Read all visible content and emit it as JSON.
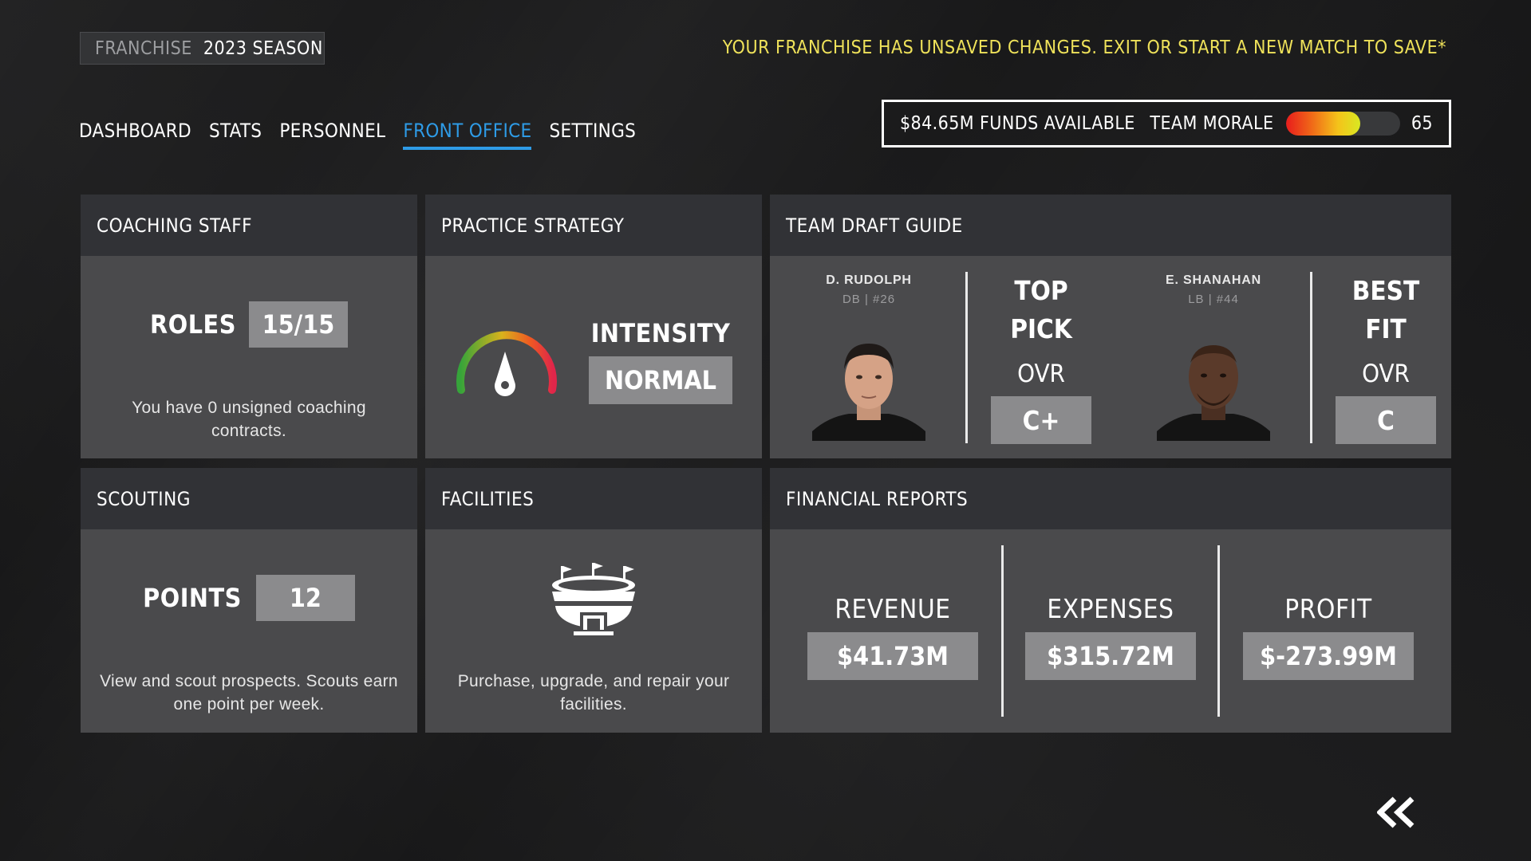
{
  "header": {
    "mode_label": "FRANCHISE",
    "season_label": "2023 SEASON",
    "unsaved_notice": "YOUR FRANCHISE HAS UNSAVED CHANGES. EXIT OR START A NEW MATCH TO SAVE*"
  },
  "nav": {
    "items": [
      "DASHBOARD",
      "STATS",
      "PERSONNEL",
      "FRONT OFFICE",
      "SETTINGS"
    ],
    "active": "FRONT OFFICE"
  },
  "status": {
    "funds": "$84.65M FUNDS AVAILABLE",
    "morale_label": "TEAM MORALE",
    "morale_value": "65",
    "morale_fraction": 0.65
  },
  "coaching": {
    "title": "COACHING STAFF",
    "roles_label": "ROLES",
    "roles_value": "15/15",
    "description": "You have 0 unsigned coaching contracts."
  },
  "practice": {
    "title": "PRACTICE STRATEGY",
    "intensity_label": "INTENSITY",
    "intensity_value": "NORMAL"
  },
  "draft": {
    "title": "TEAM DRAFT GUIDE",
    "players": [
      {
        "name": "D. RUDOLPH",
        "info": "DB | #26",
        "pick_line1": "TOP",
        "pick_line2": "PICK",
        "ovr_label": "OVR",
        "grade": "C+"
      },
      {
        "name": "E. SHANAHAN",
        "info": "LB | #44",
        "pick_line1": "BEST",
        "pick_line2": "FIT",
        "ovr_label": "OVR",
        "grade": "C"
      }
    ]
  },
  "scouting": {
    "title": "SCOUTING",
    "points_label": "POINTS",
    "points_value": "12",
    "description": "View and scout prospects. Scouts earn one point per week."
  },
  "facilities": {
    "title": "FACILITIES",
    "description": "Purchase, upgrade, and repair your facilities."
  },
  "finance": {
    "title": "FINANCIAL REPORTS",
    "revenue_label": "REVENUE",
    "revenue_value": "$41.73M",
    "expenses_label": "EXPENSES",
    "expenses_value": "$315.72M",
    "profit_label": "PROFIT",
    "profit_value": "$-273.99M"
  },
  "icons": {
    "gauge": "intensity-gauge-icon",
    "stadium": "stadium-icon",
    "back": "double-chevron-left-icon"
  },
  "colors": {
    "accent_blue": "#2e9be6",
    "warning_yellow": "#efe25a",
    "card_bg": "#4a4a4c",
    "card_header": "#313236",
    "value_box": "#8b8b8d"
  }
}
